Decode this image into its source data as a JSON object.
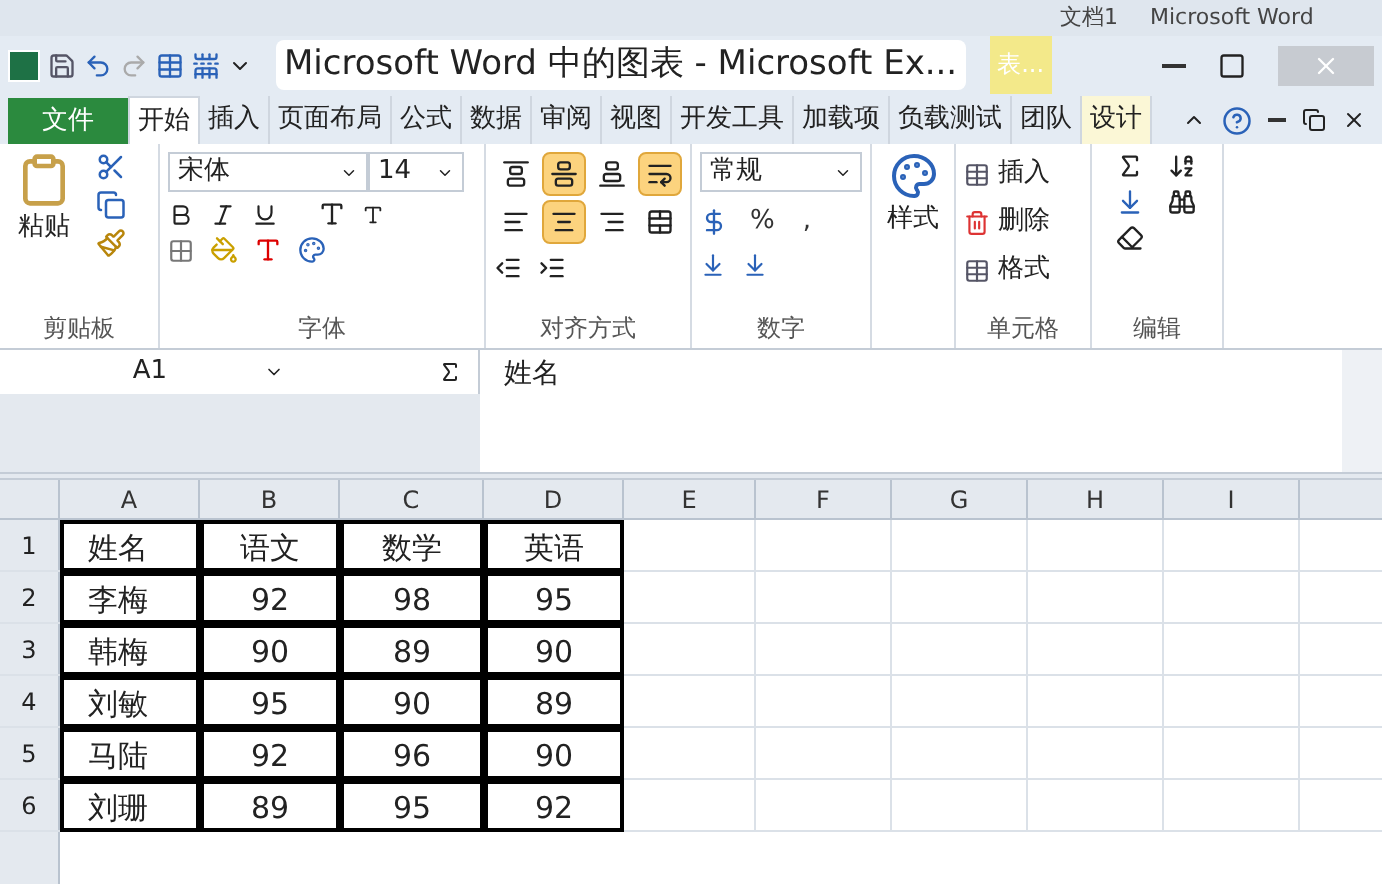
{
  "background_window": {
    "texts": [
      "文档1",
      "Microsoft Word"
    ]
  },
  "window": {
    "title": "Microsoft Word 中的图表 - Microsoft Ex...",
    "context_tab": "表..."
  },
  "file_tab": "文件",
  "tabs": [
    {
      "label": "开始",
      "selected": true
    },
    {
      "label": "插入",
      "selected": false
    },
    {
      "label": "页面布局",
      "selected": false
    },
    {
      "label": "公式",
      "selected": false
    },
    {
      "label": "数据",
      "selected": false
    },
    {
      "label": "审阅",
      "selected": false
    },
    {
      "label": "视图",
      "selected": false
    },
    {
      "label": "开发工具",
      "selected": false
    },
    {
      "label": "加载项",
      "selected": false
    },
    {
      "label": "负载测试",
      "selected": false
    },
    {
      "label": "团队",
      "selected": false
    },
    {
      "label": "设计",
      "selected": false,
      "kind": "context"
    }
  ],
  "ribbon": {
    "clipboard": {
      "label": "剪贴板",
      "paste": "粘贴"
    },
    "font": {
      "label": "字体",
      "name": "宋体",
      "size": "14"
    },
    "alignment": {
      "label": "对齐方式",
      "buttons": [
        {
          "kind": "top",
          "selected": false
        },
        {
          "kind": "middle",
          "selected": true
        },
        {
          "kind": "bottom",
          "selected": false
        },
        {
          "kind": "wrap",
          "selected": true
        },
        {
          "kind": "left",
          "selected": false
        },
        {
          "kind": "center",
          "selected": true
        },
        {
          "kind": "right",
          "selected": false
        },
        {
          "kind": "merge",
          "selected": false
        }
      ]
    },
    "number": {
      "label": "数字",
      "format": "常规",
      "percent": "%",
      "comma": ","
    },
    "styles": {
      "button": "样式"
    },
    "cells": {
      "label": "单元格",
      "buttons": [
        "插入",
        "删除",
        "格式"
      ]
    },
    "editing": {
      "label": "编辑"
    }
  },
  "formula_bar": {
    "name_box": "A1",
    "content": "姓名"
  },
  "sheet": {
    "columns": [
      "A",
      "B",
      "C",
      "D",
      "E",
      "F",
      "G",
      "H",
      "I"
    ],
    "rows": [
      {
        "number": "1",
        "cells": [
          "姓名",
          "语文",
          "数学",
          "英语"
        ]
      },
      {
        "number": "2",
        "cells": [
          "李梅",
          "92",
          "98",
          "95"
        ]
      },
      {
        "number": "3",
        "cells": [
          "韩梅",
          "90",
          "89",
          "90"
        ]
      },
      {
        "number": "4",
        "cells": [
          "刘敏",
          "95",
          "90",
          "89"
        ]
      },
      {
        "number": "5",
        "cells": [
          "马陆",
          "92",
          "96",
          "90"
        ]
      },
      {
        "number": "6",
        "cells": [
          "刘珊",
          "89",
          "95",
          "92"
        ]
      }
    ]
  }
}
